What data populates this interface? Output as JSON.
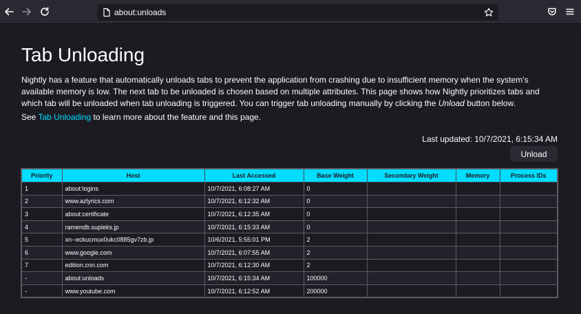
{
  "toolbar": {
    "url": "about:unloads"
  },
  "page": {
    "title": "Tab Unloading",
    "description_1": "Nightly has a feature that automatically unloads tabs to prevent the application from crashing due to insufficient memory when the system’s available memory is low. The next tab to be unloaded is chosen based on multiple attributes. This page shows how Nightly prioritizes tabs and which tab will be unloaded when tab unloading is triggered. You can trigger tab unloading manually by clicking the ",
    "description_em": "Unload",
    "description_2": " button below.",
    "see_prefix": "See ",
    "see_link": "Tab Unloading",
    "see_suffix": " to learn more about the feature and this page.",
    "last_updated": "Last updated: 10/7/2021, 6:15:34 AM",
    "unload_label": "Unload"
  },
  "table": {
    "headers": [
      "Priority",
      "Host",
      "Last Accessed",
      "Base Weight",
      "Secondary Weight",
      "Memory",
      "Process IDs"
    ],
    "rows": [
      [
        "1",
        "about:logins",
        "10/7/2021, 6:08:27 AM",
        "0",
        "",
        "",
        ""
      ],
      [
        "2",
        "www.azlyrics.com",
        "10/7/2021, 6:12:32 AM",
        "0",
        "",
        "",
        ""
      ],
      [
        "3",
        "about:certificate",
        "10/7/2021, 6:12:35 AM",
        "0",
        "",
        "",
        ""
      ],
      [
        "4",
        "ramendb.supleks.jp",
        "10/7/2021, 6:15:33 AM",
        "0",
        "",
        "",
        ""
      ],
      [
        "5",
        "xn--eckucmux0ukc0885gv7zb.jp",
        "10/6/2021, 5:55:01 PM",
        "2",
        "",
        "",
        ""
      ],
      [
        "6",
        "www.google.com",
        "10/7/2021, 6:07:55 AM",
        "2",
        "",
        "",
        ""
      ],
      [
        "7",
        "edition.cnn.com",
        "10/7/2021, 6:12:30 AM",
        "2",
        "",
        "",
        ""
      ],
      [
        "-",
        "about:unloads",
        "10/7/2021, 6:15:34 AM",
        "100000",
        "",
        "",
        ""
      ],
      [
        "-",
        "www.youtube.com",
        "10/7/2021, 6:12:52 AM",
        "200000",
        "",
        "",
        ""
      ]
    ]
  }
}
